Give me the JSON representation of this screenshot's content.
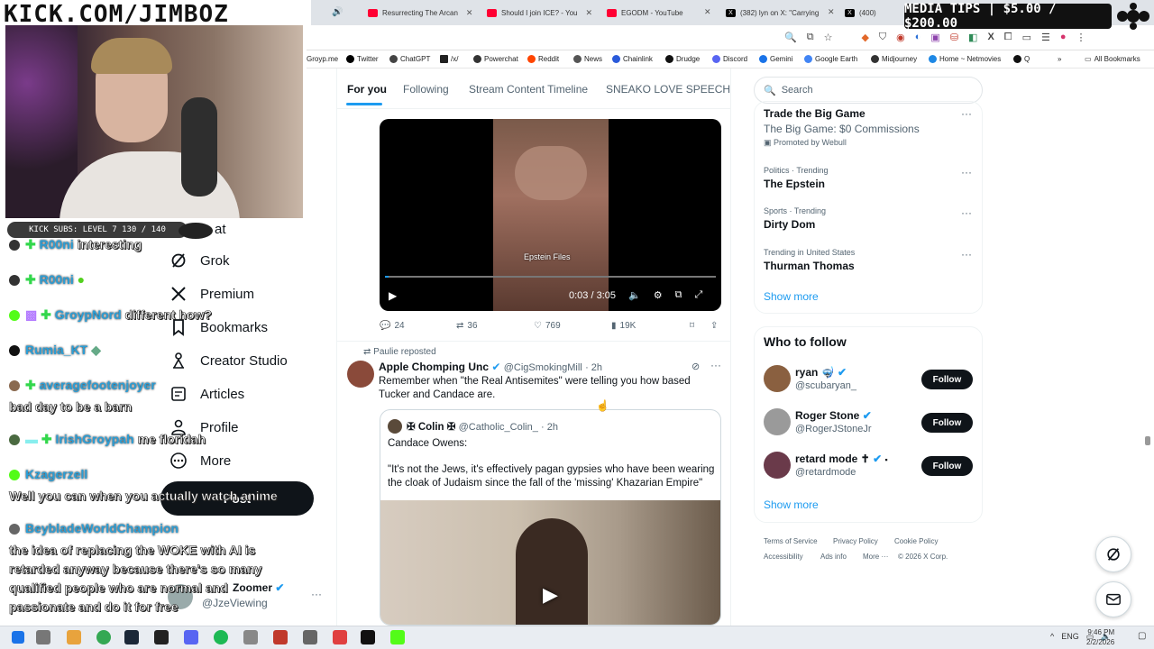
{
  "overlay": {
    "logo_text": "KICK.COM/JIMBOZ",
    "media_tips": "MEDIA TIPS | $5.00 / $200.00",
    "kick_subs": "KICK SUBS: LEVEL 7 130 / 140"
  },
  "browser": {
    "tabs": [
      {
        "label": "Resurrecting The Arcan",
        "color": "#ff0033"
      },
      {
        "label": "Should I join ICE? - You",
        "color": "#ff0033"
      },
      {
        "label": "EGODM - YouTube",
        "color": "#ff0033"
      },
      {
        "label": "(382) lyn on X: \"Carrying",
        "color": "#000000"
      },
      {
        "label": "(400)",
        "color": "#000000"
      }
    ],
    "bookmarks": [
      "Groyp.me",
      "Twitter",
      "ChatGPT",
      "/x/",
      "Powerchat",
      "Reddit",
      "News",
      "Chainlink",
      "Drudge",
      "Discord",
      "Gemini",
      "Google Earth",
      "Midjourney",
      "Home ~ Netmovies",
      "Q"
    ],
    "all_bookmarks": "All Bookmarks"
  },
  "nav": {
    "partial": "at",
    "items": [
      "Grok",
      "Premium",
      "Bookmarks",
      "Creator Studio",
      "Articles",
      "Profile",
      "More"
    ],
    "post_button": "Post",
    "account_name": "Zoomer",
    "account_handle": "@JzeViewing"
  },
  "chat": [
    {
      "user": "R00ni",
      "msg": "interesting"
    },
    {
      "user": "R00ni",
      "msg": ""
    },
    {
      "user": "GroypNord",
      "msg": "different how?"
    },
    {
      "user": "Rumia_KT",
      "msg": ""
    },
    {
      "user": "averagefootenjoyer",
      "msg": "bad day to be a barn"
    },
    {
      "user": "IrishGroypah",
      "msg": "me floridah"
    },
    {
      "user": "Kzagerzell",
      "msg": "Well you can when you actually watch anime"
    },
    {
      "user": "BeybladeWorldChampion",
      "msg": "the idea of replacing the WOKE with AI is retarded anyway because there's so many qualified people who are normal and passionate and do it for free"
    }
  ],
  "timeline": {
    "tabs": [
      "For you",
      "Following",
      "Stream Content Timeline",
      "SNEAKO LOVE SPEECH"
    ],
    "post1": {
      "video_caption": "Epstein Files",
      "video_time": "0:03 / 3:05",
      "replies": "24",
      "reposts": "36",
      "likes": "769",
      "views": "19K"
    },
    "post2": {
      "reposted_by": "Paulie reposted",
      "name": "Apple Chomping Unc",
      "handle": "@CigSmokingMill",
      "time": "· 2h",
      "text": "Remember when \"the Real Antisemites\" were telling you how based Tucker and Candace are.",
      "quote_name": "✠ Colin ✠",
      "quote_handle": "@Catholic_Colin_",
      "quote_time": "· 2h",
      "quote_line1": "Candace Owens:",
      "quote_line2": "\"It's not the Jews, it's effectively pagan gypsies who have been wearing the cloak of Judaism since the fall of the 'missing' Khazarian Empire\""
    }
  },
  "sidebar": {
    "search_placeholder": "Search",
    "trends": [
      {
        "context": "",
        "title": "Trade the Big Game",
        "sub": "The Big Game: $0 Commissions",
        "promo": "Promoted by Webull"
      },
      {
        "context": "Politics · Trending",
        "title": "The Epstein"
      },
      {
        "context": "Sports · Trending",
        "title": "Dirty Dom"
      },
      {
        "context": "Trending in United States",
        "title": "Thurman Thomas"
      }
    ],
    "show_more": "Show more",
    "who_to_follow_title": "Who to follow",
    "follow": [
      {
        "name": "ryan",
        "handle": "@scubaryan_"
      },
      {
        "name": "Roger Stone",
        "handle": "@RogerJStoneJr"
      },
      {
        "name": "retard mode ✝",
        "handle": "@retardmode"
      }
    ],
    "follow_label": "Follow",
    "show_more_2": "Show more",
    "footer": [
      "Terms of Service",
      "Privacy Policy",
      "Cookie Policy",
      "Accessibility",
      "Ads info",
      "More ···",
      "© 2026 X Corp."
    ]
  },
  "taskbar": {
    "lang": "ENG",
    "time": "9:46 PM",
    "date": "2/2/2026"
  }
}
